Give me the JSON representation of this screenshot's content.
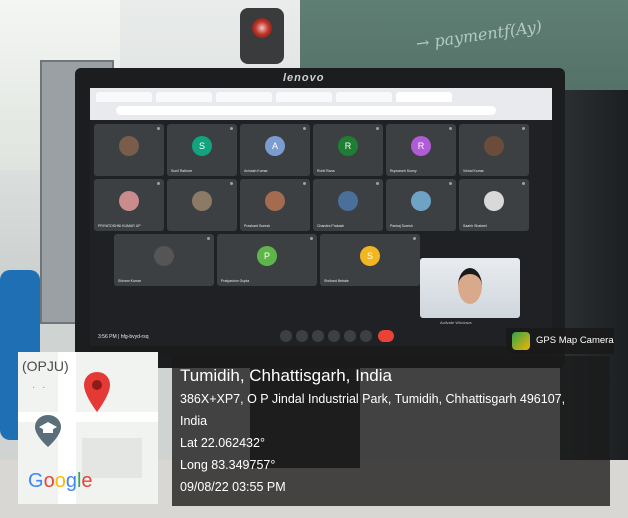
{
  "monitor": {
    "brand": "lenovo"
  },
  "board": {
    "writing": "→ paymentf(Ay)"
  },
  "meeting": {
    "time_label": "3:56 PM",
    "meeting_name": "| hfg-bvyd-rsq",
    "activate_windows": "Activate Windows",
    "participants": [
      {
        "name": "",
        "initial": "",
        "color": "#7a5c4a"
      },
      {
        "name": "Sunil Rathore",
        "initial": "S",
        "color": "#12a37f"
      },
      {
        "name": "Avinash Kumar",
        "initial": "A",
        "color": "#7b9bd1"
      },
      {
        "name": "Rohit Rana",
        "initial": "R",
        "color": "#1e7e34"
      },
      {
        "name": "Rupvaseh Sonny",
        "initial": "R",
        "color": "#b05cd6"
      },
      {
        "name": "Vishal Kumar",
        "initial": "",
        "color": "#6b4b3a"
      },
      {
        "name": "PRIYATOSHNI KUMAR UP",
        "initial": "",
        "color": "#c98b8b"
      },
      {
        "name": "",
        "initial": "",
        "color": "#8b7a66"
      },
      {
        "name": "Prashant Suresh",
        "initial": "",
        "color": "#a56b4f"
      },
      {
        "name": "Chandra Prakash",
        "initial": "",
        "color": "#4a6f9b"
      },
      {
        "name": "Pankaj Suresh",
        "initial": "",
        "color": "#6fa3c6"
      },
      {
        "name": "Saahir Shakeel",
        "initial": "",
        "color": "#d9d9d9"
      },
      {
        "name": "Shivam Kumar",
        "initial": "",
        "color": "#555555"
      },
      {
        "name": "Pratyashnn Gupta",
        "initial": "P",
        "color": "#5fb54a"
      },
      {
        "name": "Shrikant Bebale",
        "initial": "S",
        "color": "#f1b620"
      }
    ]
  },
  "overlay": {
    "app_label": "GPS Map Camera",
    "map_label": "(OPJU)",
    "map_dots": "· ·",
    "map_brand": "Google",
    "place": "Tumidih, Chhattisgarh, India",
    "address_line1": "386X+XP7, O P Jindal Industrial Park, Tumidih, Chhattisgarh 496107,",
    "address_line2": "India",
    "lat": "Lat 22.062432°",
    "long": "Long 83.349757°",
    "datetime": "09/08/22 03:55 PM"
  },
  "colors": {
    "pin": "#e53935",
    "info_bg": "#191919"
  }
}
